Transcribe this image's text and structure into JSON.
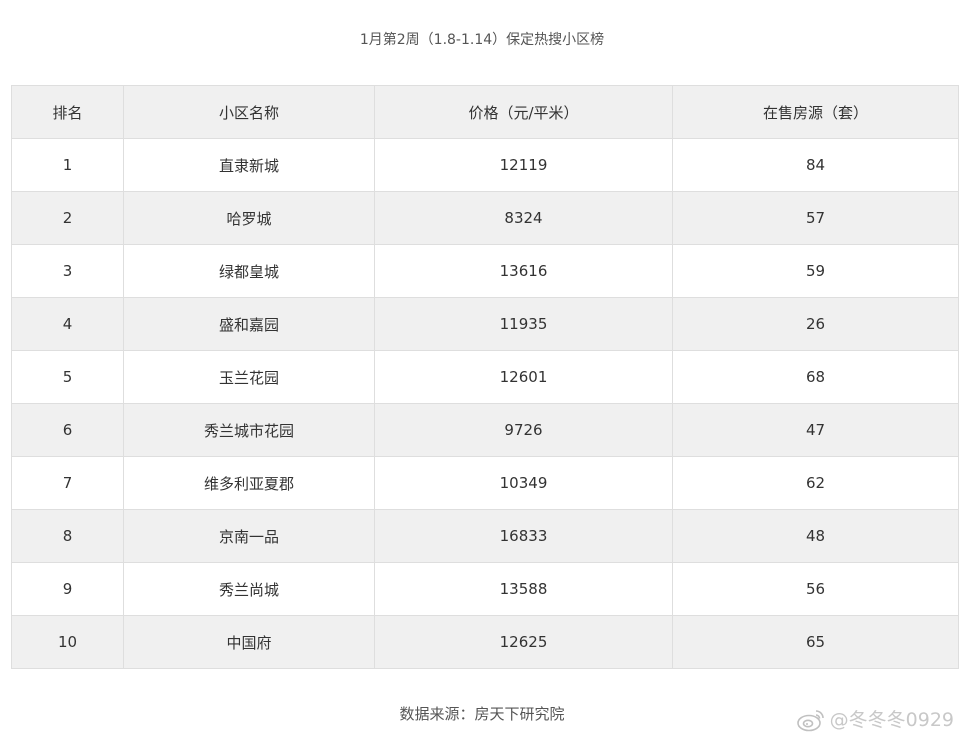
{
  "caption": "1月第2周（1.8-1.14）保定热搜小区榜",
  "table": {
    "headers": [
      "排名",
      "小区名称",
      "价格（元/平米）",
      "在售房源（套）"
    ],
    "rows": [
      [
        "1",
        "直隶新城",
        "12119",
        "84"
      ],
      [
        "2",
        "哈罗城",
        "8324",
        "57"
      ],
      [
        "3",
        "绿都皇城",
        "13616",
        "59"
      ],
      [
        "4",
        "盛和嘉园",
        "11935",
        "26"
      ],
      [
        "5",
        "玉兰花园",
        "12601",
        "68"
      ],
      [
        "6",
        "秀兰城市花园",
        "9726",
        "47"
      ],
      [
        "7",
        "维多利亚夏郡",
        "10349",
        "62"
      ],
      [
        "8",
        "京南一品",
        "16833",
        "48"
      ],
      [
        "9",
        "秀兰尚城",
        "13588",
        "56"
      ],
      [
        "10",
        "中国府",
        "12625",
        "65"
      ]
    ]
  },
  "source": "数据来源：房天下研究院",
  "watermark": {
    "icon": "weibo-icon",
    "text": "@冬冬冬0929"
  }
}
